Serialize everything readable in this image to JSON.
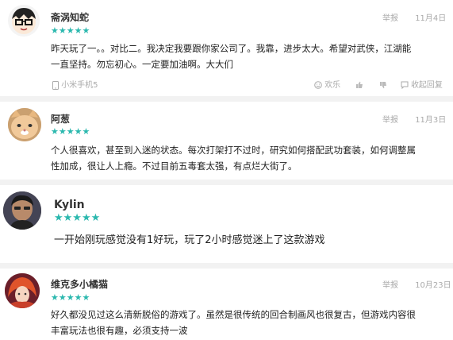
{
  "reviews": [
    {
      "username": "斋涡知蛇",
      "stars": "★★★★★",
      "report_label": "举报",
      "date": "11月4日",
      "text_line1": "昨天玩了一。。对比二。我决定我要跟你家公司了。我靠，进步太大。希望对武侠，江湖能",
      "text_line2": "一直坚持。勿忘初心。一定要加油啊。大大们",
      "device": "小米手机5",
      "happy_label": "欢乐",
      "collapse_label": "收起回复"
    },
    {
      "username": "阿葱",
      "stars": "★★★★★",
      "report_label": "举报",
      "date": "11月3日",
      "text_line1": "个人很喜欢，甚至到入迷的状态。每次打架打不过时，研究如何搭配武功套装，如何调整属",
      "text_line2": "性加成，很让人上瘾。不过目前五毒套太强，有点烂大街了。"
    },
    {
      "username": "Kylin",
      "stars": "★★★★★",
      "text_line1": "一开始刚玩感觉没有1好玩，玩了2小时感觉迷上了这款游戏"
    },
    {
      "username": "维克多小橘猫",
      "stars": "★★★★★",
      "report_label": "举报",
      "date": "10月23日",
      "text_line1": "好久都没见过这么清新脱俗的游戏了。虽然是很传统的回合制画风也很复古，但游戏内容很",
      "text_line2": "丰富玩法也很有趣，必须支持一波"
    }
  ],
  "colors": {
    "star": "#2bb8ae",
    "divider": "#f2f2f2",
    "muted": "#aaaaaa"
  }
}
